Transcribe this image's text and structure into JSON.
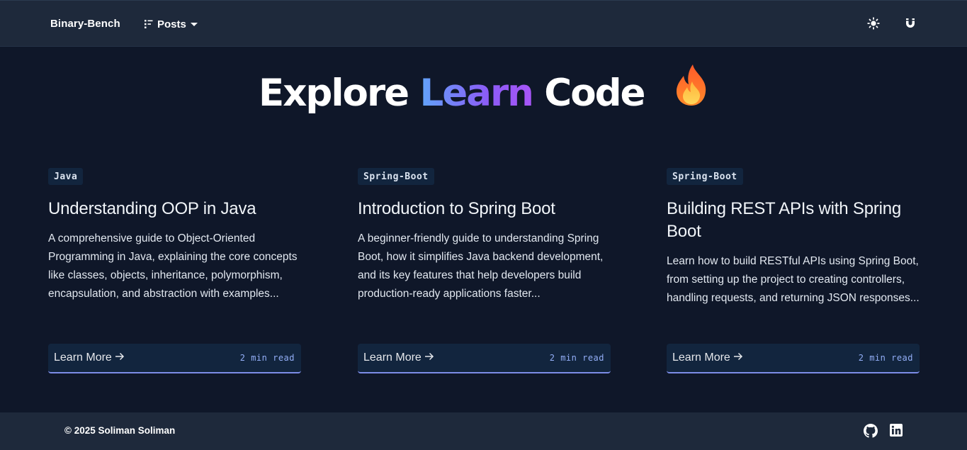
{
  "nav": {
    "brand": "Binary-Bench",
    "posts_label": "Posts",
    "icons": [
      "list-icon",
      "caret-down-icon",
      "sun-icon",
      "magnet-icon"
    ]
  },
  "hero": {
    "word1": "Explore",
    "word2": "Learn",
    "word3": "Code",
    "emoji": "fire-emoji"
  },
  "posts": [
    {
      "tag": "Java",
      "title": "Understanding OOP in Java",
      "description": "A comprehensive guide to Object-Oriented Programming in Java, explaining the core concepts like classes, objects, inheritance, polymorphism, encapsulation, and abstraction with examples...",
      "cta": "Learn More",
      "read_time": "2 min read"
    },
    {
      "tag": "Spring-Boot",
      "title": "Introduction to Spring Boot",
      "description": "A beginner-friendly guide to understanding Spring Boot, how it simplifies Java backend development, and its key features that help developers build production-ready applications faster...",
      "cta": "Learn More",
      "read_time": "2 min read"
    },
    {
      "tag": "Spring-Boot",
      "title": "Building REST APIs with Spring Boot",
      "description": "Learn how to build RESTful APIs using Spring Boot, from setting up the project to creating controllers, handling requests, and returning JSON responses...",
      "cta": "Learn More",
      "read_time": "2 min read"
    }
  ],
  "footer": {
    "copyright": "© 2025 Soliman Soliman",
    "icons": [
      "github-icon",
      "linkedin-icon"
    ]
  },
  "colors": {
    "background": "#0f1729",
    "navbar": "#1e293b",
    "card_footer": "#12253e",
    "accent_border": "#7c8ce6",
    "read_time": "#93aef7",
    "gradient_start": "#60a5fa",
    "gradient_end": "#a855f7"
  }
}
